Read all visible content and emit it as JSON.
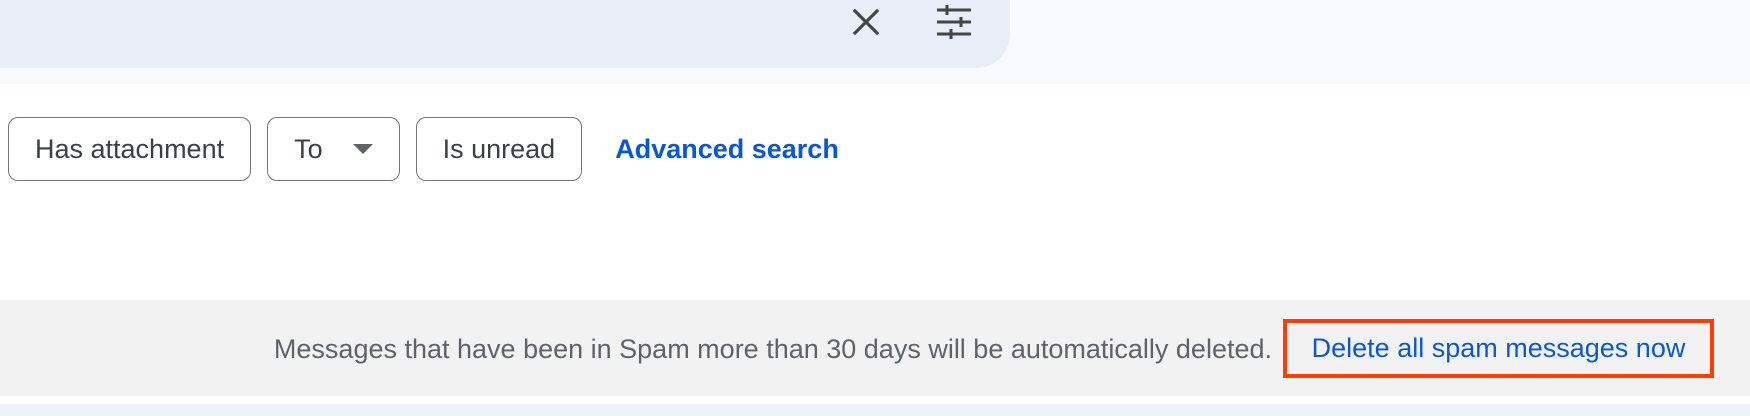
{
  "search": {
    "close_icon": "close-icon",
    "filter_icon": "tune-icon"
  },
  "filters": {
    "chips": [
      {
        "label": "Has attachment"
      },
      {
        "label": "To",
        "has_dropdown": true
      },
      {
        "label": "Is unread"
      }
    ],
    "advanced_search_label": "Advanced search"
  },
  "spam_banner": {
    "message": "Messages that have been in Spam more than 30 days will be automatically deleted.",
    "delete_link": "Delete all spam messages now"
  },
  "colors": {
    "link": "#0b57d0",
    "highlight_border": "#ff3d00"
  }
}
